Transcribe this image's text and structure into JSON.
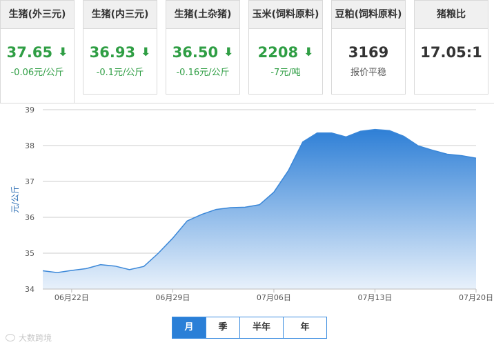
{
  "cards": [
    {
      "title": "生猪(外三元)",
      "price": "37.65",
      "trend": "down",
      "arrow": "⬇",
      "change": "-0.06元/公斤"
    },
    {
      "title": "生猪(内三元)",
      "price": "36.93",
      "trend": "down",
      "arrow": "⬇",
      "change": "-0.1元/公斤"
    },
    {
      "title": "生猪(土杂猪)",
      "price": "36.50",
      "trend": "down",
      "arrow": "⬇",
      "change": "-0.16元/公斤"
    },
    {
      "title": "玉米(饲料原料)",
      "price": "2208",
      "trend": "down",
      "arrow": "⬇",
      "change": "-7元/吨"
    },
    {
      "title": "豆粕(饲料原料)",
      "price": "3169",
      "trend": "flat",
      "arrow": "",
      "change": "报价平稳"
    },
    {
      "title": "猪粮比",
      "price": "17.05:1",
      "trend": "none",
      "arrow": "",
      "change": ""
    }
  ],
  "tabs": [
    {
      "label": "月",
      "selected": true
    },
    {
      "label": "季",
      "selected": false
    },
    {
      "label": "半年",
      "selected": false
    },
    {
      "label": "年",
      "selected": false
    }
  ],
  "watermark": "大数跨境",
  "colors": {
    "down": "#2f9e44",
    "line": "#3a87d8",
    "grid": "#cccccc",
    "tab_active": "#2a7fd7"
  },
  "chart_data": {
    "type": "area",
    "title": "",
    "xlabel": "",
    "ylabel": "元/公斤",
    "ylim": [
      34,
      39
    ],
    "yticks": [
      34,
      35,
      36,
      37,
      38,
      39
    ],
    "xticks": [
      "06月22日",
      "06月29日",
      "07月06日",
      "07月13日",
      "07月20日"
    ],
    "grid": true,
    "series": [
      {
        "x": [
          "06月20日",
          "06月21日",
          "06月22日",
          "06月23日",
          "06月24日",
          "06月25日",
          "06月26日",
          "06月27日",
          "06月28日",
          "06月29日",
          "06月30日",
          "07月01日",
          "07月02日",
          "07月03日",
          "07月04日",
          "07月05日",
          "07月06日",
          "07月07日",
          "07月08日",
          "07月09日",
          "07月10日",
          "07月11日",
          "07月12日",
          "07月13日",
          "07月14日",
          "07月15日",
          "07月16日",
          "07月17日",
          "07月18日",
          "07月19日",
          "07月20日"
        ],
        "values": [
          34.51,
          34.46,
          34.52,
          34.57,
          34.68,
          34.64,
          34.54,
          34.63,
          35.0,
          35.42,
          35.9,
          36.08,
          36.22,
          36.27,
          36.28,
          36.35,
          36.7,
          37.3,
          38.1,
          38.35,
          38.35,
          38.24,
          38.4,
          38.45,
          38.42,
          38.26,
          37.99,
          37.87,
          37.76,
          37.72,
          37.65
        ]
      }
    ]
  }
}
